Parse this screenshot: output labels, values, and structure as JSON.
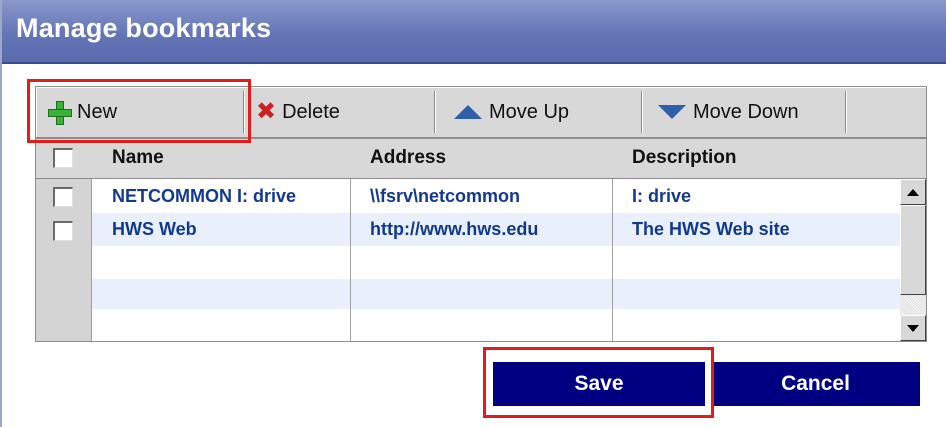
{
  "window": {
    "title": "Manage bookmarks"
  },
  "toolbar": {
    "new_label": "New",
    "delete_label": "Delete",
    "move_up_label": "Move Up",
    "move_down_label": "Move Down"
  },
  "table": {
    "columns": [
      "Name",
      "Address",
      "Description"
    ],
    "rows": [
      {
        "name": "NETCOMMON I: drive",
        "address": "\\\\fsrv\\netcommon",
        "description": "I: drive"
      },
      {
        "name": "HWS Web",
        "address": "http://www.hws.edu",
        "description": "The HWS Web site"
      }
    ]
  },
  "buttons": {
    "save": "Save",
    "cancel": "Cancel"
  },
  "colors": {
    "titlebar": "#6475b6",
    "button_bg": "#000080",
    "link_text": "#123a8c",
    "highlight": "#e01c1c",
    "row_alt": "#eaf0fb"
  }
}
